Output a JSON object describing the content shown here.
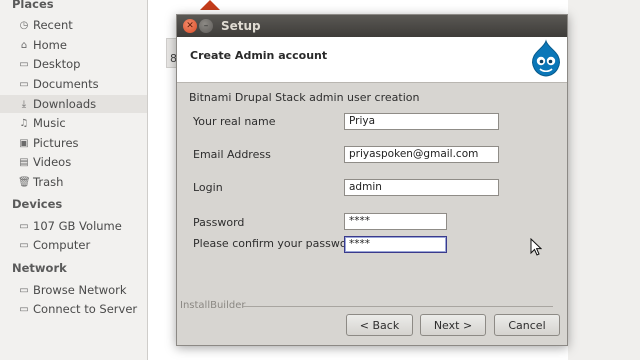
{
  "sidebar": {
    "places_header": "Places",
    "places": [
      {
        "label": "Recent",
        "icon": "clock-icon"
      },
      {
        "label": "Home",
        "icon": "home-icon"
      },
      {
        "label": "Desktop",
        "icon": "desktop-folder-icon"
      },
      {
        "label": "Documents",
        "icon": "documents-folder-icon"
      },
      {
        "label": "Downloads",
        "icon": "download-icon"
      },
      {
        "label": "Music",
        "icon": "music-icon"
      },
      {
        "label": "Pictures",
        "icon": "pictures-icon"
      },
      {
        "label": "Videos",
        "icon": "videos-icon"
      },
      {
        "label": "Trash",
        "icon": "trash-icon"
      }
    ],
    "devices_header": "Devices",
    "devices": [
      {
        "label": "107 GB Volume",
        "icon": "drive-icon"
      },
      {
        "label": "Computer",
        "icon": "computer-icon"
      }
    ],
    "network_header": "Network",
    "network": [
      {
        "label": "Browse Network",
        "icon": "network-icon"
      },
      {
        "label": "Connect to Server",
        "icon": "server-icon"
      }
    ],
    "active_item": "Downloads"
  },
  "background": {
    "partial_text": "8"
  },
  "dialog": {
    "window_title": "Setup",
    "banner_title": "Create Admin account",
    "subtitle": "Bitnami Drupal Stack admin user creation",
    "fields": {
      "real_name": {
        "label": "Your real name",
        "value": "Priya"
      },
      "email": {
        "label": "Email Address",
        "value": "priyaspoken@gmail.com"
      },
      "login": {
        "label": "Login",
        "value": "admin"
      },
      "password": {
        "label": "Password",
        "value": "****"
      },
      "confirm_password": {
        "label": "Please confirm your password",
        "value": "****"
      }
    },
    "footer_label": "InstallBuilder",
    "buttons": {
      "back": "< Back",
      "next": "Next >",
      "cancel": "Cancel"
    }
  },
  "colors": {
    "accent_close": "#d84d28",
    "titlebar": "#3e3c39",
    "dialog_bg": "#d7d5d1",
    "drupal_blue": "#0b77b8"
  }
}
